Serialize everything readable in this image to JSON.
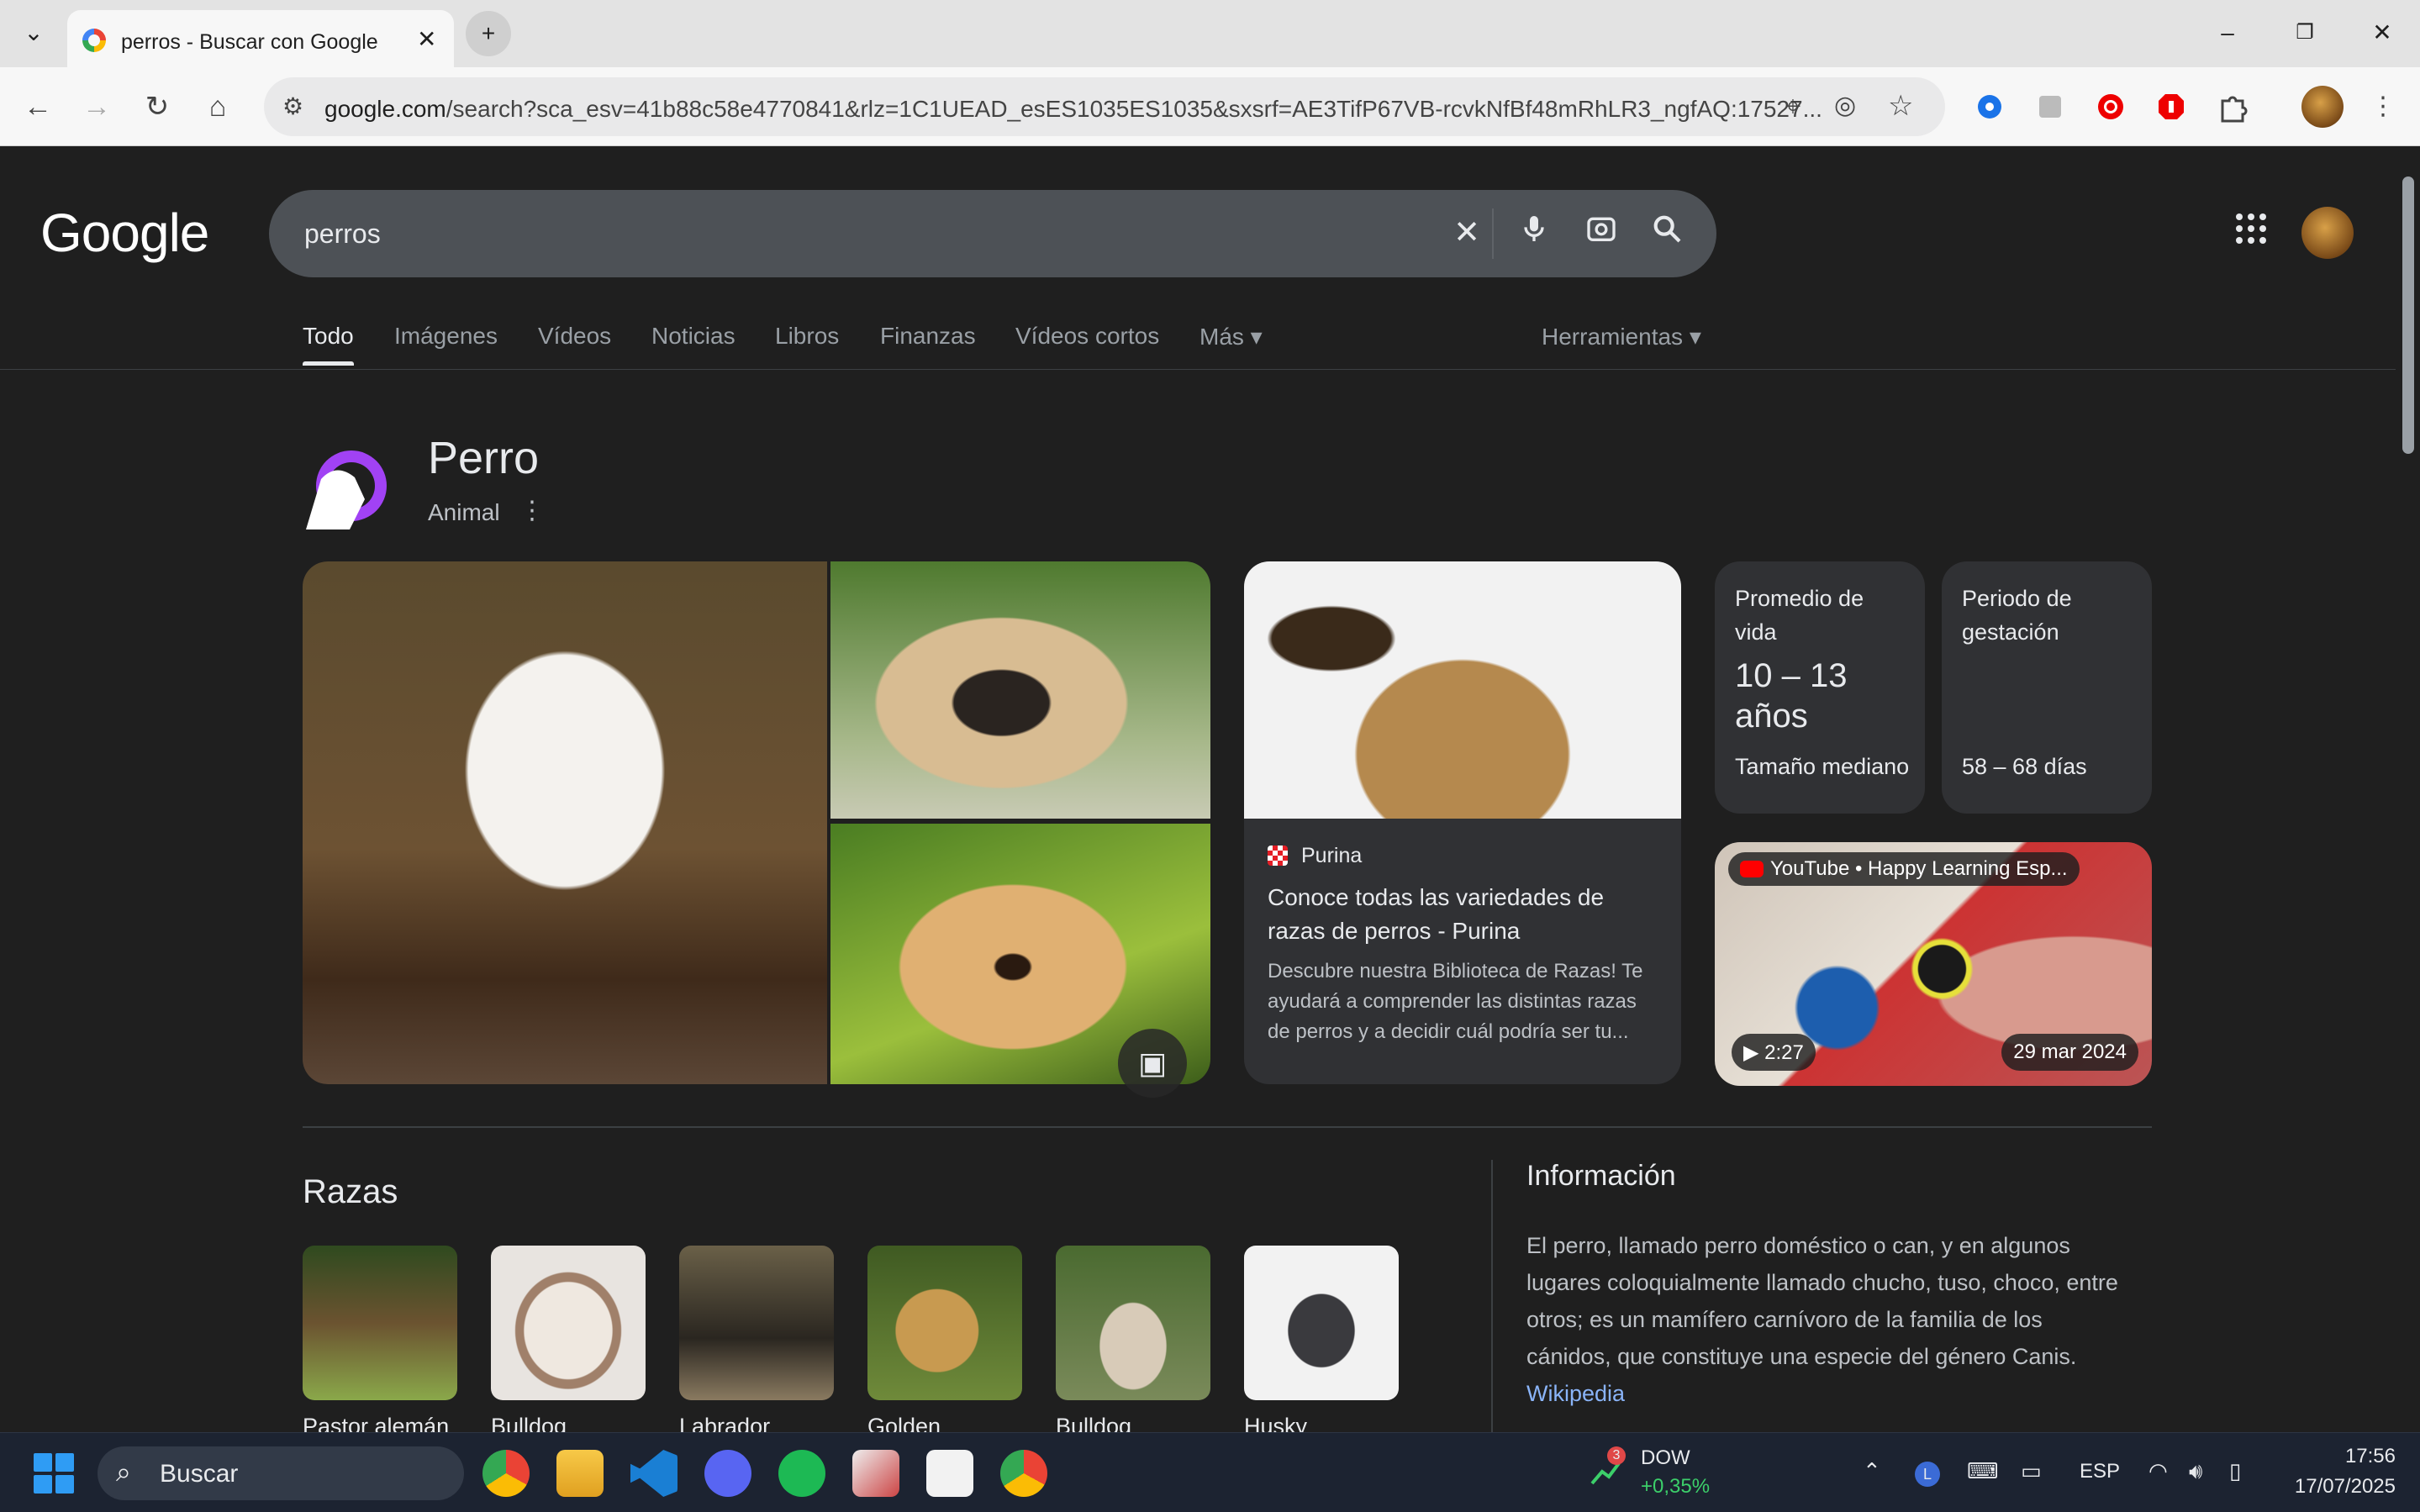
{
  "browser": {
    "tab_title": "perros - Buscar con Google",
    "url_host": "google.com",
    "url_path": "/search?sca_esv=41b88c58e4770841&rlz=1C1UEAD_esES1035ES1035&sxsrf=AE3TifP67VB-rcvkNfBf48mRhLR3_ngfAQ:17527..."
  },
  "search": {
    "logo": "Google",
    "query": "perros",
    "tabs": [
      "Todo",
      "Imágenes",
      "Vídeos",
      "Noticias",
      "Libros",
      "Finanzas",
      "Vídeos cortos",
      "Más ▾"
    ],
    "tools": "Herramientas ▾"
  },
  "knowledge_panel": {
    "title": "Perro",
    "subtitle": "Animal",
    "purina": {
      "source": "Purina",
      "title": "Conoce todas las variedades de razas de perros - Purina",
      "description": "Descubre nuestra Biblioteca de Razas! Te ayudará a comprender las distintas razas de perros y a decidir cuál podría ser tu..."
    },
    "facts": [
      {
        "label": "Promedio de vida",
        "value": "10 – 13 años",
        "extra": "Tamaño mediano"
      },
      {
        "label": "Periodo de gestación",
        "value": "",
        "extra": "58 – 68 días"
      }
    ],
    "video": {
      "source": "YouTube • Happy Learning Esp...",
      "duration": "▶ 2:27",
      "date": "29 mar 2024"
    }
  },
  "razas": {
    "title": "Razas",
    "items": [
      {
        "name": "Pastor alemán",
        "color": "#6b5330"
      },
      {
        "name": "Bulldog",
        "color": "#cfc7bf"
      },
      {
        "name": "Labrador",
        "color": "#3a3a30"
      },
      {
        "name": "Golden",
        "color": "#a88a4a"
      },
      {
        "name": "Bulldog",
        "color": "#6a7a4a"
      },
      {
        "name": "Husky",
        "color": "#9aa8b8"
      }
    ]
  },
  "info": {
    "title": "Información",
    "text": "El perro,  llamado perro doméstico o can,  y en algunos lugares coloquialmente llamado chucho,  tuso,  choco, entre otros; es un mamífero carnívoro de la familia de los cánidos, que constituye una especie del género Canis.",
    "link": "Wikipedia"
  },
  "taskbar": {
    "search": "Buscar",
    "stock_name": "DOW",
    "stock_change": "+0,35%",
    "stock_badge": "3",
    "language": "ESP",
    "time": "17:56",
    "date": "17/07/2025"
  },
  "colors": {
    "page_bg": "#1f1f1f",
    "card_bg": "#303134",
    "link": "#8ab4f8",
    "accent_purple": "#a142f4"
  }
}
